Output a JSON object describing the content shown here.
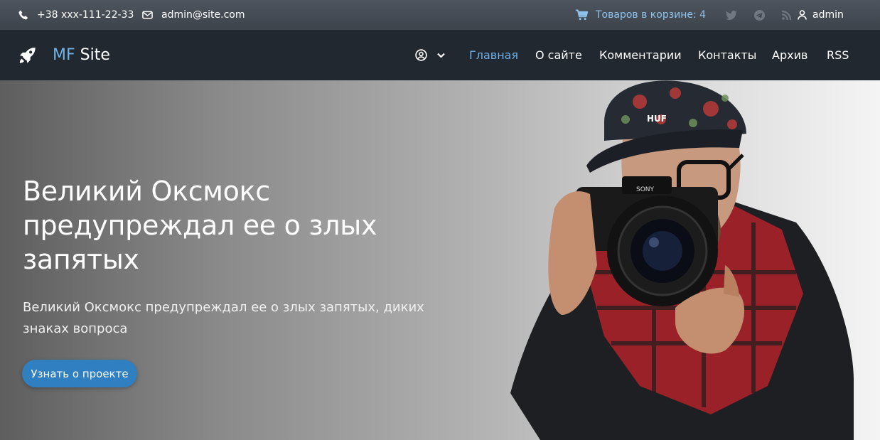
{
  "topbar": {
    "phone": "+38 xxx-111-22-33",
    "email": "admin@site.com",
    "cart": "Товаров в корзине: 4",
    "user": "admin",
    "social_icons": [
      "twitter-icon",
      "telegram-icon",
      "rss-icon"
    ]
  },
  "navbar": {
    "brand_mf": "MF",
    "brand_site": " Site",
    "menu": [
      {
        "label": "Главная",
        "active": true
      },
      {
        "label": "О сайте",
        "active": false
      },
      {
        "label": "Комментарии",
        "active": false
      },
      {
        "label": "Контакты",
        "active": false
      },
      {
        "label": "Архив",
        "active": false
      },
      {
        "label": "RSS",
        "active": false
      }
    ]
  },
  "hero": {
    "title": "Великий Оксмокс предупреждал ее о злых запятых",
    "subtitle": "Великий Оксмокс предупреждал ее о злых запятых, диких знаках вопроса",
    "button": "Узнать о проекте"
  },
  "colors": {
    "accent": "#6db0e8",
    "button": "#2f7fc1",
    "topbar": "#454c54",
    "navbar": "#222830"
  }
}
